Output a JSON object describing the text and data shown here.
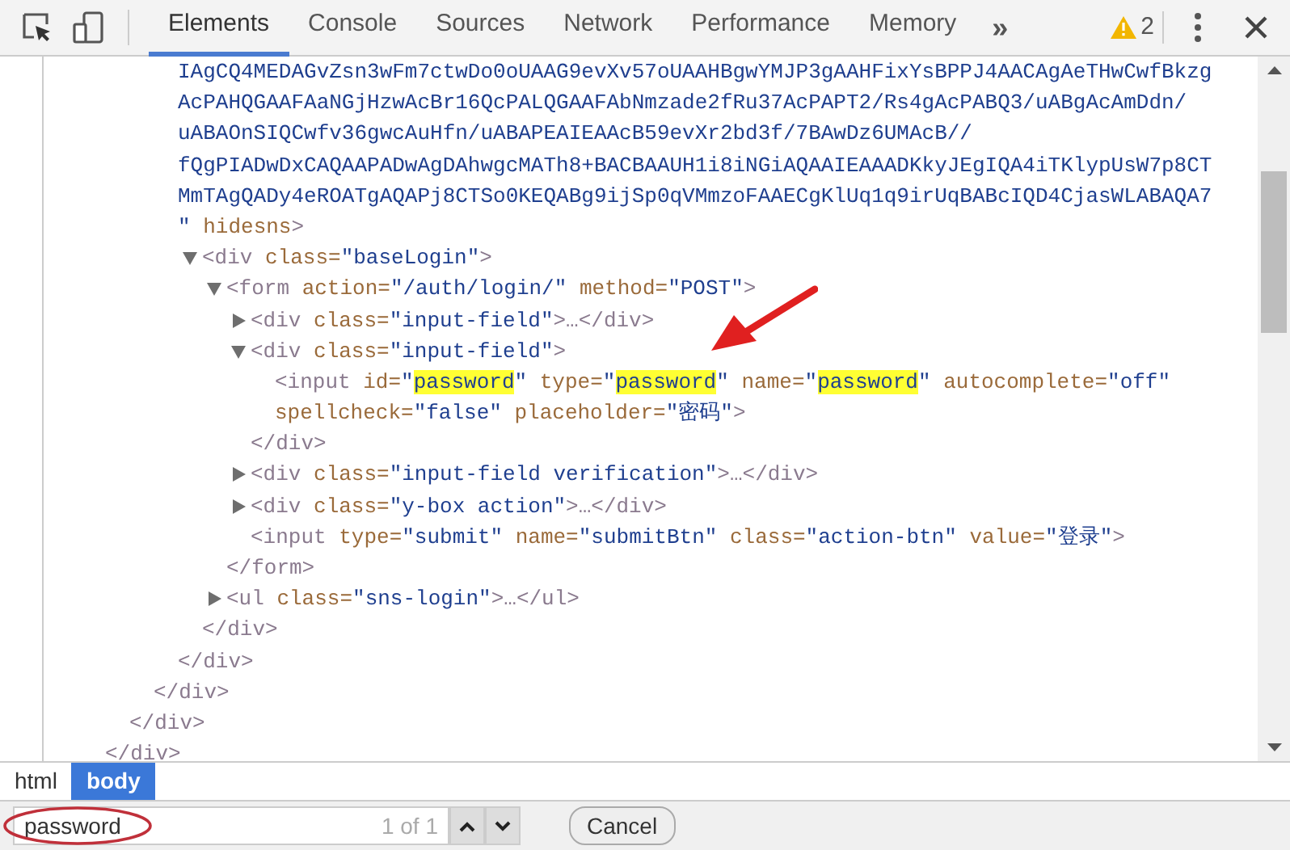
{
  "toolbar": {
    "tabs": [
      {
        "label": "Elements",
        "selected": true
      },
      {
        "label": "Console",
        "selected": false
      },
      {
        "label": "Sources",
        "selected": false
      },
      {
        "label": "Network",
        "selected": false
      },
      {
        "label": "Performance",
        "selected": false
      },
      {
        "label": "Memory",
        "selected": false
      }
    ],
    "overflow": "»",
    "warning_count": "2"
  },
  "tree": [
    {
      "close": [
        {
          "kind": "tag",
          "text": "</div>"
        }
      ],
      "children": [
        {
          "close": [
            {
              "kind": "tag",
              "text": "</div>"
            }
          ],
          "children": [
            {
              "close": [
                {
                  "kind": "tag",
                  "text": "</div>"
                }
              ],
              "children": [
                {
                  "lines": [
                    [
                      {
                        "kind": "value",
                        "text": "IAgCQ4MEDAGvZsn3wFm7ctwDo0oUAAG9evXv57oUAAHBgwYMJP3gAAHFixYsBPPJ4AACAgAeTHwCwfBkzg"
                      }
                    ],
                    [
                      {
                        "kind": "value",
                        "text": "AcPAHQGAAFAaNGjHzwAcBr16QcPALQGAAFAbNmzade2fRu37AcPAPT2/Rs4gAcPABQ3/uABgAcAmDdn/"
                      }
                    ],
                    [
                      {
                        "kind": "value",
                        "text": "uABAOnSIQCwfv36gwcAuHfn/uABAPEAIEAAcB59evXr2bd3f/7BAwDz6UMAcB//"
                      }
                    ],
                    [
                      {
                        "kind": "value",
                        "text": "fQgPIADwDxCAQAAPADwAgDAhwgcMATh8+BACBAAUH1i8iNGiAQAAIEAAADKkyJEgIQA4iTKlypUsW7p8CT"
                      }
                    ],
                    [
                      {
                        "kind": "value",
                        "text": "MmTAgQADy4eROATgAQAPj8CTSo0KEQABg9ijSp0qVMmzoFAAECgKlUq1q9irUqBABcIQD4CjasWLABAQA7"
                      }
                    ],
                    [
                      {
                        "kind": "value",
                        "text": "\""
                      },
                      {
                        "kind": "attr",
                        "text": " hidesns"
                      },
                      {
                        "kind": "tag",
                        "text": ">"
                      }
                    ]
                  ],
                  "close": [
                    {
                      "kind": "tag",
                      "text": "</div>"
                    }
                  ],
                  "children": [
                    {
                      "expanded": true,
                      "lines": [
                        [
                          {
                            "kind": "tag",
                            "text": "<div"
                          },
                          {
                            "kind": "attr",
                            "text": " class="
                          },
                          {
                            "kind": "value",
                            "text": "\"baseLogin\""
                          },
                          {
                            "kind": "tag",
                            "text": ">"
                          }
                        ]
                      ],
                      "close": [
                        {
                          "kind": "tag",
                          "text": "</div>"
                        }
                      ],
                      "children": [
                        {
                          "expanded": true,
                          "lines": [
                            [
                              {
                                "kind": "tag",
                                "text": "<form"
                              },
                              {
                                "kind": "attr",
                                "text": " action="
                              },
                              {
                                "kind": "value",
                                "text": "\"/auth/login/\""
                              },
                              {
                                "kind": "attr",
                                "text": " method="
                              },
                              {
                                "kind": "value",
                                "text": "\"POST\""
                              },
                              {
                                "kind": "tag",
                                "text": ">"
                              }
                            ]
                          ],
                          "close": [
                            {
                              "kind": "tag",
                              "text": "</form>"
                            }
                          ],
                          "children": [
                            {
                              "expanded": false,
                              "lines": [
                                [
                                  {
                                    "kind": "tag",
                                    "text": "<div"
                                  },
                                  {
                                    "kind": "attr",
                                    "text": " class="
                                  },
                                  {
                                    "kind": "value",
                                    "text": "\"input-field\""
                                  },
                                  {
                                    "kind": "tag",
                                    "text": ">…</div>"
                                  }
                                ]
                              ]
                            },
                            {
                              "expanded": true,
                              "lines": [
                                [
                                  {
                                    "kind": "tag",
                                    "text": "<div"
                                  },
                                  {
                                    "kind": "attr",
                                    "text": " class="
                                  },
                                  {
                                    "kind": "value",
                                    "text": "\"input-field\""
                                  },
                                  {
                                    "kind": "tag",
                                    "text": ">"
                                  }
                                ]
                              ],
                              "close": [
                                {
                                  "kind": "tag",
                                  "text": "</div>"
                                }
                              ],
                              "children": [
                                {
                                  "lines": [
                                    [
                                      {
                                        "kind": "tag",
                                        "text": "<input"
                                      },
                                      {
                                        "kind": "attr",
                                        "text": " id="
                                      },
                                      {
                                        "kind": "value",
                                        "text": "\""
                                      },
                                      {
                                        "kind": "match",
                                        "text": "password"
                                      },
                                      {
                                        "kind": "value",
                                        "text": "\""
                                      },
                                      {
                                        "kind": "attr",
                                        "text": " type="
                                      },
                                      {
                                        "kind": "value",
                                        "text": "\""
                                      },
                                      {
                                        "kind": "match",
                                        "text": "password"
                                      },
                                      {
                                        "kind": "value",
                                        "text": "\""
                                      },
                                      {
                                        "kind": "attr",
                                        "text": " name="
                                      },
                                      {
                                        "kind": "value",
                                        "text": "\""
                                      },
                                      {
                                        "kind": "match",
                                        "text": "password"
                                      },
                                      {
                                        "kind": "value",
                                        "text": "\""
                                      },
                                      {
                                        "kind": "attr",
                                        "text": " autocomplete="
                                      },
                                      {
                                        "kind": "value",
                                        "text": "\"off\""
                                      }
                                    ],
                                    [
                                      {
                                        "kind": "attr",
                                        "text": "spellcheck="
                                      },
                                      {
                                        "kind": "value",
                                        "text": "\"false\""
                                      },
                                      {
                                        "kind": "attr",
                                        "text": " placeholder="
                                      },
                                      {
                                        "kind": "value",
                                        "text": "\"密码\""
                                      },
                                      {
                                        "kind": "tag",
                                        "text": ">"
                                      }
                                    ]
                                  ]
                                }
                              ]
                            },
                            {
                              "expanded": false,
                              "lines": [
                                [
                                  {
                                    "kind": "tag",
                                    "text": "<div"
                                  },
                                  {
                                    "kind": "attr",
                                    "text": " class="
                                  },
                                  {
                                    "kind": "value",
                                    "text": "\"input-field verification\""
                                  },
                                  {
                                    "kind": "tag",
                                    "text": ">…</div>"
                                  }
                                ]
                              ]
                            },
                            {
                              "expanded": false,
                              "lines": [
                                [
                                  {
                                    "kind": "tag",
                                    "text": "<div"
                                  },
                                  {
                                    "kind": "attr",
                                    "text": " class="
                                  },
                                  {
                                    "kind": "value",
                                    "text": "\"y-box action\""
                                  },
                                  {
                                    "kind": "tag",
                                    "text": ">…</div>"
                                  }
                                ]
                              ]
                            },
                            {
                              "lines": [
                                [
                                  {
                                    "kind": "tag",
                                    "text": "<input"
                                  },
                                  {
                                    "kind": "attr",
                                    "text": " type="
                                  },
                                  {
                                    "kind": "value",
                                    "text": "\"submit\""
                                  },
                                  {
                                    "kind": "attr",
                                    "text": " name="
                                  },
                                  {
                                    "kind": "value",
                                    "text": "\"submitBtn\""
                                  },
                                  {
                                    "kind": "attr",
                                    "text": " class="
                                  },
                                  {
                                    "kind": "value",
                                    "text": "\"action-btn\""
                                  },
                                  {
                                    "kind": "attr",
                                    "text": " value="
                                  },
                                  {
                                    "kind": "value",
                                    "text": "\"登录\""
                                  },
                                  {
                                    "kind": "tag",
                                    "text": ">"
                                  }
                                ]
                              ]
                            }
                          ]
                        },
                        {
                          "expanded": false,
                          "lines": [
                            [
                              {
                                "kind": "tag",
                                "text": "<ul"
                              },
                              {
                                "kind": "attr",
                                "text": " class="
                              },
                              {
                                "kind": "value",
                                "text": "\"sns-login\""
                              },
                              {
                                "kind": "tag",
                                "text": ">…</ul>"
                              }
                            ]
                          ]
                        }
                      ]
                    }
                  ]
                }
              ]
            }
          ]
        }
      ]
    }
  ],
  "breadcrumbs": [
    {
      "label": "html",
      "selected": false
    },
    {
      "label": "body",
      "selected": true
    }
  ],
  "search": {
    "value": "password",
    "count": "1 of 1",
    "cancel": "Cancel"
  }
}
